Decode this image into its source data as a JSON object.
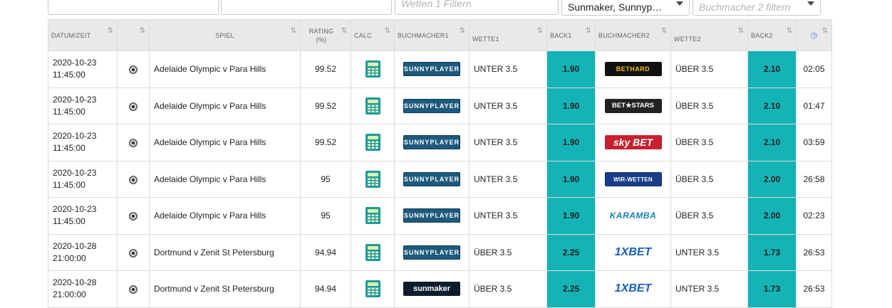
{
  "filters": {
    "bookmaker1_filter_value": "",
    "game_filter_value": "",
    "bets1_placeholder": "Wetten 1 Filtern",
    "bookmakers1_selected": "Sunmaker, Sunnyp…",
    "bookmakers2_placeholder": "Buchmacher 2 filtern"
  },
  "table": {
    "headers": {
      "datetime": "DATUM/ZEIT",
      "game": "SPIEL",
      "rating": "RATING",
      "rating_unit": "(%)",
      "calc": "CALC",
      "bookmaker1": "BUCHMACHER1",
      "bet1": "WETTE1",
      "back1": "BACK1",
      "bookmaker2": "BUCHMACHER2",
      "bet2": "WETTE2",
      "back2": "BACK2",
      "sort_glyph": "⇅",
      "clock_glyph": "◷"
    },
    "rows": [
      {
        "date": "2020-10-23",
        "time": "11:45:00",
        "sport": "soccer-ball-icon",
        "game": "Adelaide Olympic v Para Hills",
        "rating": "99.52",
        "bookmaker1": "SUNNYPLAYER",
        "bookmaker1_logo": "sunnyplayer",
        "bet1": "UNTER 3.5",
        "back1": "1.90",
        "bookmaker2": "BETHARD",
        "bookmaker2_logo": "bethard",
        "bet2": "ÜBER 3.5",
        "back2": "2.10",
        "age": "02:05"
      },
      {
        "date": "2020-10-23",
        "time": "11:45:00",
        "sport": "soccer-ball-icon",
        "game": "Adelaide Olympic v Para Hills",
        "rating": "99.52",
        "bookmaker1": "SUNNYPLAYER",
        "bookmaker1_logo": "sunnyplayer",
        "bet1": "UNTER 3.5",
        "back1": "1.90",
        "bookmaker2": "BET★STARS",
        "bookmaker2_logo": "betstars",
        "bet2": "ÜBER 3.5",
        "back2": "2.10",
        "age": "01:47"
      },
      {
        "date": "2020-10-23",
        "time": "11:45:00",
        "sport": "soccer-ball-icon",
        "game": "Adelaide Olympic v Para Hills",
        "rating": "99.52",
        "bookmaker1": "SUNNYPLAYER",
        "bookmaker1_logo": "sunnyplayer",
        "bet1": "UNTER 3.5",
        "back1": "1.90",
        "bookmaker2": "sky BET",
        "bookmaker2_logo": "skybet",
        "bet2": "ÜBER 3.5",
        "back2": "2.10",
        "age": "03:59"
      },
      {
        "date": "2020-10-23",
        "time": "11:45:00",
        "sport": "soccer-ball-icon",
        "game": "Adelaide Olympic v Para Hills",
        "rating": "95",
        "bookmaker1": "SUNNYPLAYER",
        "bookmaker1_logo": "sunnyplayer",
        "bet1": "UNTER 3.5",
        "back1": "1.90",
        "bookmaker2": "WIR-WETTEN",
        "bookmaker2_logo": "wirwetten",
        "bet2": "ÜBER 3.5",
        "back2": "2.00",
        "age": "26:58"
      },
      {
        "date": "2020-10-23",
        "time": "11:45:00",
        "sport": "soccer-ball-icon",
        "game": "Adelaide Olympic v Para Hills",
        "rating": "95",
        "bookmaker1": "SUNNYPLAYER",
        "bookmaker1_logo": "sunnyplayer",
        "bet1": "UNTER 3.5",
        "back1": "1.90",
        "bookmaker2": "KARAMBA",
        "bookmaker2_logo": "karamba",
        "bet2": "ÜBER 3.5",
        "back2": "2.00",
        "age": "02:23"
      },
      {
        "date": "2020-10-28",
        "time": "21:00:00",
        "sport": "soccer-ball-icon",
        "game": "Dortmund v Zenit St Petersburg",
        "rating": "94.94",
        "bookmaker1": "SUNNYPLAYER",
        "bookmaker1_logo": "sunnyplayer",
        "bet1": "ÜBER 3.5",
        "back1": "2.25",
        "bookmaker2": "1XBET",
        "bookmaker2_logo": "1xbet",
        "bet2": "UNTER 3.5",
        "back2": "1.73",
        "age": "26:53"
      },
      {
        "date": "2020-10-28",
        "time": "21:00:00",
        "sport": "soccer-ball-icon",
        "game": "Dortmund v Zenit St Petersburg",
        "rating": "94.94",
        "bookmaker1": "sunmaker",
        "bookmaker1_logo": "sunmaker",
        "bet1": "ÜBER 3.5",
        "back1": "2.25",
        "bookmaker2": "1XBET",
        "bookmaker2_logo": "1xbet",
        "bet2": "UNTER 3.5",
        "back2": "1.73",
        "age": "26:53"
      }
    ]
  },
  "colors": {
    "back_highlight": "#14b3b6",
    "header_bg": "#e9e9e9",
    "calc_icon": "#1f9a9a"
  },
  "icons": {
    "sport": "soccer-ball-icon",
    "calc": "calculator-icon",
    "sort": "sort-arrows-icon",
    "clock": "clock-icon",
    "dropdown": "chevron-down-icon"
  }
}
